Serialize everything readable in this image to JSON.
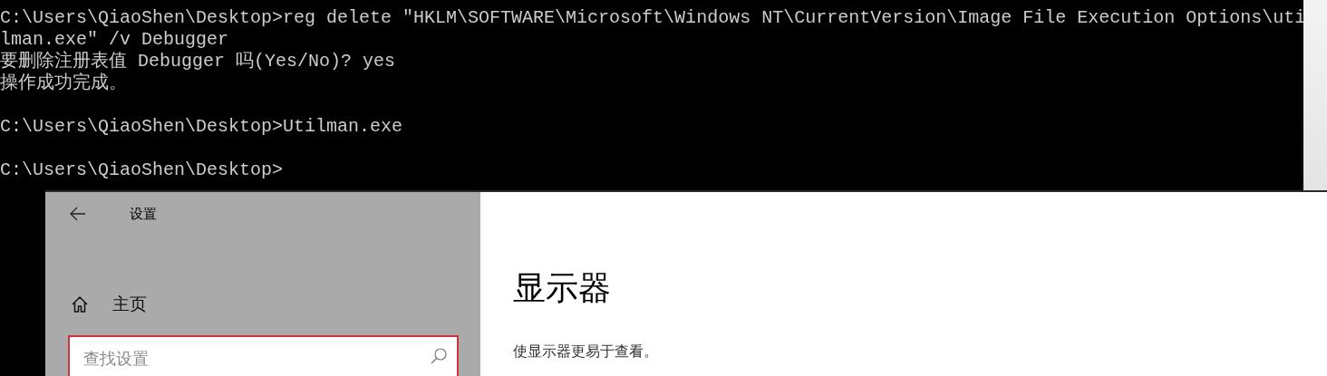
{
  "console": {
    "blocks": [
      {
        "lines": [
          "C:\\Users\\QiaoShen\\Desktop>reg delete \"HKLM\\SOFTWARE\\Microsoft\\Windows NT\\CurrentVersion\\Image File Execution Options\\uti",
          "lman.exe\" /v Debugger",
          "要删除注册表值 Debugger 吗(Yes/No)? yes",
          "操作成功完成。"
        ]
      },
      {
        "lines": [
          "C:\\Users\\QiaoShen\\Desktop>Utilman.exe"
        ]
      },
      {
        "lines": [
          "C:\\Users\\QiaoShen\\Desktop>"
        ]
      }
    ]
  },
  "settings": {
    "title": "设置",
    "sidebar": {
      "home": "主页",
      "search": {
        "placeholder": "查找设置",
        "focused": true
      }
    },
    "page": {
      "heading": "显示器",
      "description": "使显示器更易于查看。"
    }
  }
}
